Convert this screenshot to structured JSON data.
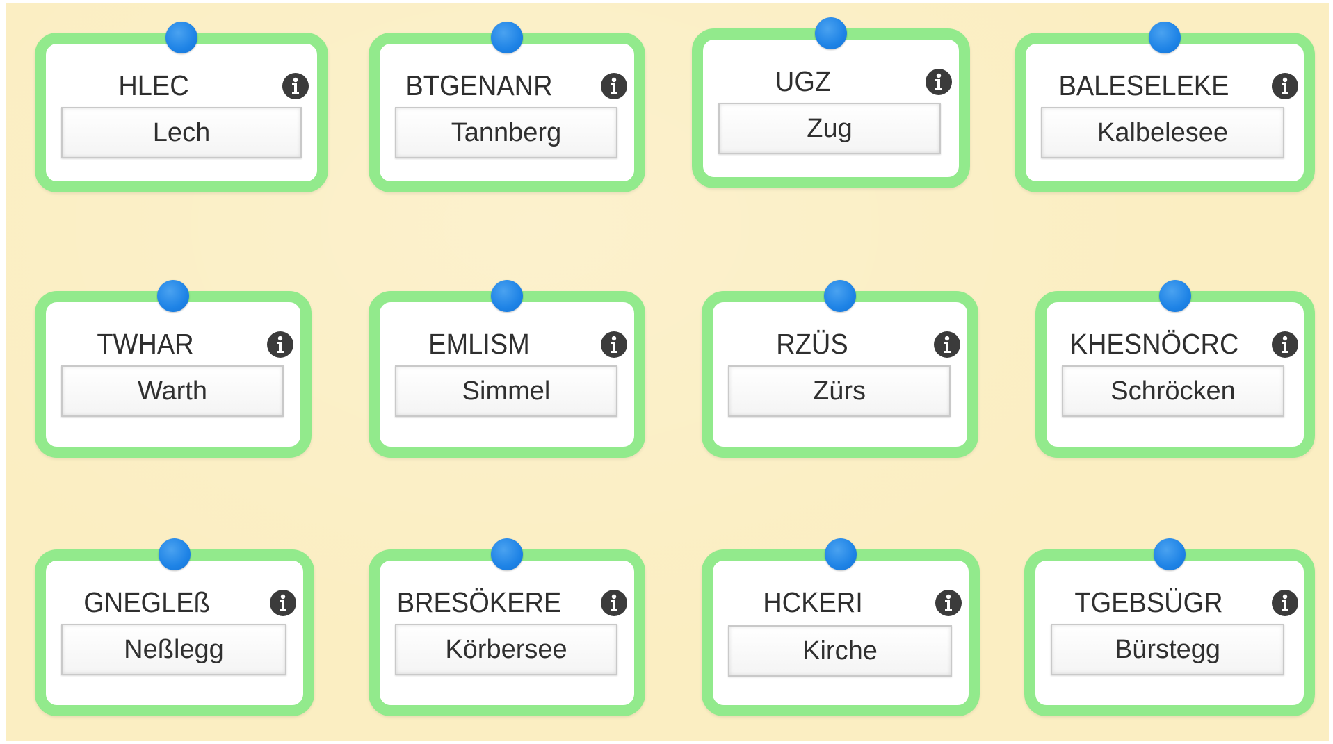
{
  "cards": [
    {
      "scrambled": "HLEC",
      "answer": "Lech",
      "info_icon": "info-icon"
    },
    {
      "scrambled": "BTGENANR",
      "answer": "Tannberg",
      "info_icon": "info-icon"
    },
    {
      "scrambled": "UGZ",
      "answer": "Zug",
      "info_icon": "info-icon"
    },
    {
      "scrambled": "BALESELEKE",
      "answer": "Kalbelesee",
      "info_icon": "info-icon"
    },
    {
      "scrambled": "TWHAR",
      "answer": "Warth",
      "info_icon": "info-icon"
    },
    {
      "scrambled": "EMLISM",
      "answer": "Simmel",
      "info_icon": "info-icon"
    },
    {
      "scrambled": "RZÜS",
      "answer": "Zürs",
      "info_icon": "info-icon"
    },
    {
      "scrambled": "KHESNÖCRC",
      "answer": "Schröcken",
      "info_icon": "info-icon"
    },
    {
      "scrambled": "GNEGLEß",
      "answer": "Neßlegg",
      "info_icon": "info-icon"
    },
    {
      "scrambled": "BRESÖKERE",
      "answer": "Körbersee",
      "info_icon": "info-icon"
    },
    {
      "scrambled": "HCKERI",
      "answer": "Kirche",
      "info_icon": "info-icon"
    },
    {
      "scrambled": "TGEBSÜGR",
      "answer": "Bürstegg",
      "info_icon": "info-icon"
    }
  ],
  "colors": {
    "background": "#fbeec2",
    "card_border": "#92ea8c",
    "pin": "#1e83e6",
    "text": "#2f2f2f",
    "info_icon": "#3b3b3b"
  }
}
